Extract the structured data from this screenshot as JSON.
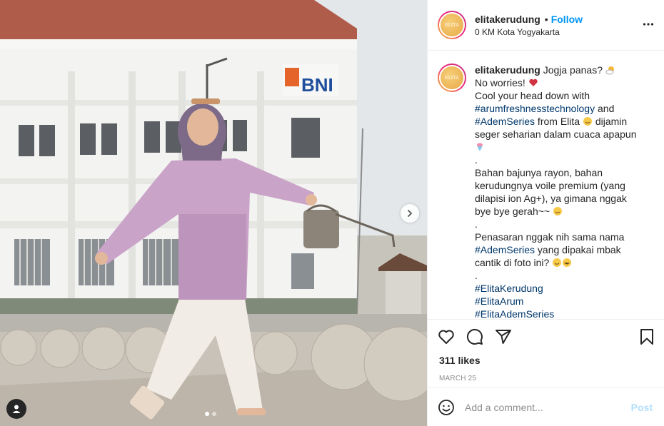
{
  "post": {
    "username": "elitakerudung",
    "follow_label": "Follow",
    "bullet": "•",
    "location": "0 KM Kota Yogyakarta",
    "avatar_logo": "ELITA",
    "building_sign": "BNI",
    "caption": {
      "username": "elitakerudung",
      "l1": "Jogja panas? ",
      "l2": "No worries! ",
      "l3": "Cool your head down with",
      "tag1": "#arumfreshnesstechnology",
      "and": " and",
      "tag2": "#AdemSeries",
      "l5a": " from Elita ",
      "l5b": " dijamin",
      "l6": "seger seharian dalam cuaca apapun",
      "dot1": ".",
      "l8": "Bahan bajunya rayon, bahan",
      "l9": "kerudungnya voile premium (yang",
      "l10": "dilapisi ion Ag+), ya gimana nggak",
      "l11": "bye bye gerah~~ ",
      "dot2": ".",
      "l13": "Penasaran nggak nih sama nama",
      "tag3": "#AdemSeries",
      "l14b": " yang dipakai mbak",
      "l15": "cantik di foto ini? ",
      "dot3": ".",
      "tag4": "#ElitaKerudung",
      "tag5": "#ElitaArum",
      "tag6": "#ElitaAdemSeries"
    },
    "likes": "311 likes",
    "date": "MARCH 25",
    "comment_placeholder": "Add a comment...",
    "post_label": "Post",
    "carousel": {
      "slides": 2,
      "active": 1
    }
  },
  "icons": [
    "more-options-icon",
    "heart-icon",
    "comment-icon",
    "share-icon",
    "bookmark-icon",
    "emoji-icon",
    "user-tag-icon",
    "chevron-right-icon"
  ],
  "colors": {
    "follow": "#0095f6",
    "hashtag": "#00376b",
    "post_disabled": "#b2dffc",
    "muted": "#8e8e8e",
    "text": "#262626"
  }
}
